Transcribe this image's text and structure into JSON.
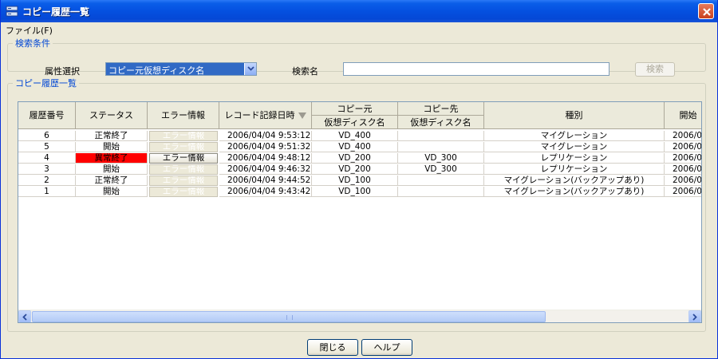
{
  "window": {
    "title": "コピー履歴一覧"
  },
  "menu": {
    "file": "ファイル(F)"
  },
  "search": {
    "legend": "検索条件",
    "attribute_label": "属性選択",
    "attribute_value": "コピー元仮想ディスク名",
    "name_label": "検索名",
    "name_value": "",
    "search_button": "検索"
  },
  "history": {
    "legend": "コピー履歴一覧",
    "columns": {
      "number": "履歴番号",
      "status": "ステータス",
      "error": "エラー情報",
      "record_time": "レコード記録日時",
      "source": "コピー元",
      "source_sub": "仮想ディスク名",
      "dest": "コピー先",
      "dest_sub": "仮想ディスク名",
      "type": "種別",
      "start": "開始"
    },
    "error_button_label": "エラー情報",
    "rows": [
      {
        "number": "6",
        "status": "正常終了",
        "error_enabled": false,
        "time": "2006/04/04 9:53:12",
        "source": "VD_400",
        "dest": "",
        "type": "マイグレーション",
        "start": "2006/0"
      },
      {
        "number": "5",
        "status": "開始",
        "error_enabled": false,
        "time": "2006/04/04 9:51:32",
        "source": "VD_400",
        "dest": "",
        "type": "マイグレーション",
        "start": "2006/0"
      },
      {
        "number": "4",
        "status": "異常終了",
        "error_enabled": true,
        "time": "2006/04/04 9:48:12",
        "source": "VD_200",
        "dest": "VD_300",
        "type": "レプリケーション",
        "start": "2006/0"
      },
      {
        "number": "3",
        "status": "開始",
        "error_enabled": false,
        "time": "2006/04/04 9:46:32",
        "source": "VD_200",
        "dest": "VD_300",
        "type": "レプリケーション",
        "start": "2006/0"
      },
      {
        "number": "2",
        "status": "正常終了",
        "error_enabled": false,
        "time": "2006/04/04 9:44:52",
        "source": "VD_100",
        "dest": "",
        "type": "マイグレーション(バックアップあり)",
        "start": "2006/0"
      },
      {
        "number": "1",
        "status": "開始",
        "error_enabled": false,
        "time": "2006/04/04 9:43:42",
        "source": "VD_100",
        "dest": "",
        "type": "マイグレーション(バックアップあり)",
        "start": "2006/0"
      }
    ]
  },
  "buttons": {
    "close": "閉じる",
    "help": "ヘルプ"
  },
  "colors": {
    "error_status": "#ff0000",
    "titlebar": "#0550e0",
    "selection": "#316ac5"
  },
  "icons": {
    "app": "storage-app-icon",
    "close": "close-icon",
    "dropdown": "chevron-down-icon",
    "sort": "sort-descending-icon"
  }
}
